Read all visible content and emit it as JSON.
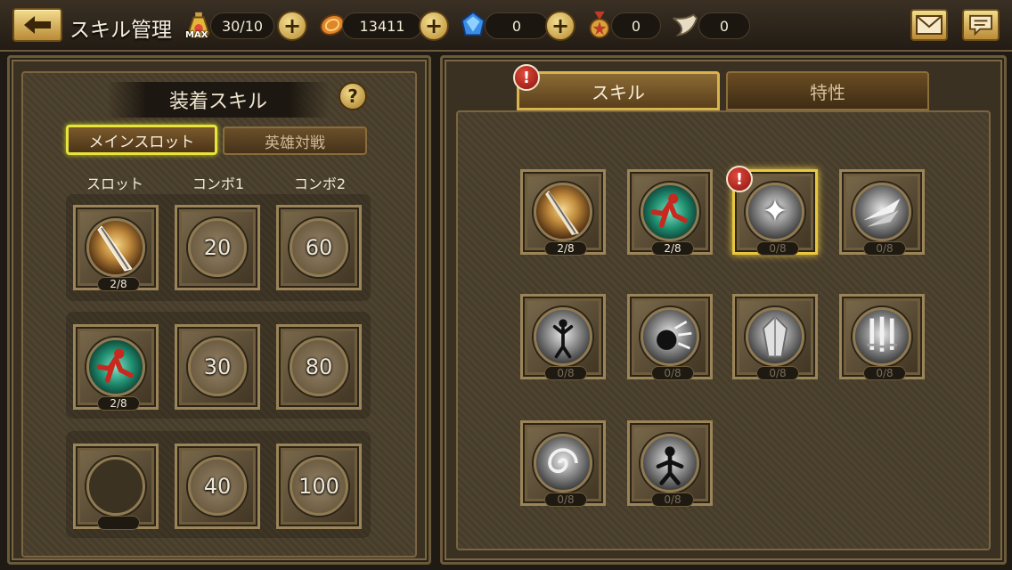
{
  "header": {
    "title": "スキル管理",
    "stamina": "30/10",
    "stamina_max_tag": "MAX",
    "gold": "13411",
    "gems": "0",
    "medals": "0",
    "horns": "0"
  },
  "left_panel": {
    "title": "装着スキル",
    "help": "?",
    "tabs": {
      "main_slot": "メインスロット",
      "hero_battle": "英雄対戦"
    },
    "columns": [
      "スロット",
      "コンボ1",
      "コンボ2"
    ],
    "rows": [
      {
        "slot_level": "2/8",
        "combo1": "20",
        "combo2": "60"
      },
      {
        "slot_level": "2/8",
        "combo1": "30",
        "combo2": "80"
      },
      {
        "slot_level": "",
        "combo1": "40",
        "combo2": "100"
      }
    ]
  },
  "right_panel": {
    "tabs": {
      "skill": "スキル",
      "trait": "特性"
    },
    "alert_mark": "!",
    "skills": [
      {
        "name": "sword-thrust",
        "level": "2/8"
      },
      {
        "name": "green-dash",
        "level": "2/8"
      },
      {
        "name": "shuriken-burst",
        "level": "0/8",
        "selected": true,
        "alert": true
      },
      {
        "name": "slash-wave",
        "level": "0/8"
      },
      {
        "name": "spirit-rise",
        "level": "0/8"
      },
      {
        "name": "impact-strike",
        "level": "0/8"
      },
      {
        "name": "crystal-shield",
        "level": "0/8"
      },
      {
        "name": "triple-blades",
        "level": "0/8"
      },
      {
        "name": "whirlwind",
        "level": "0/8"
      },
      {
        "name": "power-aura",
        "level": "0/8"
      }
    ]
  },
  "colors": {
    "accent_gold": "#d9b34c",
    "selected_green_yellow": "#e8e43a",
    "alert_red": "#c8281e"
  }
}
